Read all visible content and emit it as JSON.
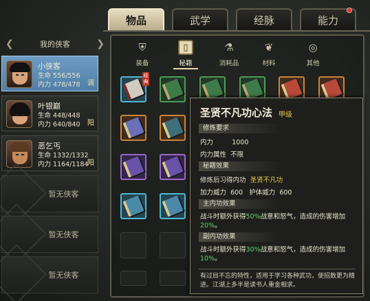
{
  "tabs": [
    {
      "label": "物品",
      "active": true
    },
    {
      "label": "武学",
      "active": false
    },
    {
      "label": "经脉",
      "active": false
    },
    {
      "label": "能力",
      "active": false,
      "badge": true
    }
  ],
  "sidebar": {
    "header": "我的侠客",
    "cards": [
      {
        "name": "小侠客",
        "hp_label": "生命",
        "hp": "556/556",
        "mp_label": "内力",
        "mp": "478/478",
        "mode": "调",
        "selected": true
      },
      {
        "name": "叶银巅",
        "hp_label": "生命",
        "hp": "448/448",
        "mp_label": "内力",
        "mp": "640/840",
        "mode": "阳",
        "selected": false
      },
      {
        "name": "恶乞丐",
        "hp_label": "生命",
        "hp": "1332/1332",
        "mp_label": "内力",
        "mp": "1164/1184",
        "mode": "阳",
        "selected": false
      }
    ],
    "empty_label": "暂无侠客"
  },
  "categories": [
    {
      "label": "装备",
      "icon": "armor-icon"
    },
    {
      "label": "秘籍",
      "icon": "book-icon",
      "active": true
    },
    {
      "label": "消耗品",
      "icon": "potion-icon"
    },
    {
      "label": "材料",
      "icon": "herb-icon"
    },
    {
      "label": "其他",
      "icon": "misc-icon"
    }
  ],
  "grid_badge": "经典",
  "tooltip": {
    "title": "圣贤不凡功心法",
    "grade": "甲级",
    "req_header": "修炼要求",
    "req1_label": "内力",
    "req1_value": "1000",
    "req2_label": "内力属性",
    "req2_value": "不限",
    "effect_header": "秘籍效果",
    "learn_label": "修炼后习得内功",
    "learn_value": "圣贤不凡功",
    "power1_label": "加力威力",
    "power1_value": "600",
    "power2_label": "护体威力",
    "power2_value": "600",
    "main_header": "主内功效果",
    "main_text_a": "战斗时额外获得",
    "main_pct1": "50%",
    "main_text_b": "战意和怒气，造成的伤害增加",
    "main_pct2": "20%",
    "main_end": "。",
    "sub_header": "副内功效果",
    "sub_text_a": "战斗时额外获得",
    "sub_pct1": "30%",
    "sub_text_b": "战意和怒气，造成的伤害增加",
    "sub_pct2": "10%",
    "sub_end": "。",
    "description": "有过目不忘的特性，适用于学习各种武功，使招数更为精进。江湖上多半是读书人重金相求。"
  },
  "colors": {
    "accent_gold": "#e8c84a",
    "green_pct": "#5fd06a",
    "selected_card": "#5f8fb8"
  }
}
